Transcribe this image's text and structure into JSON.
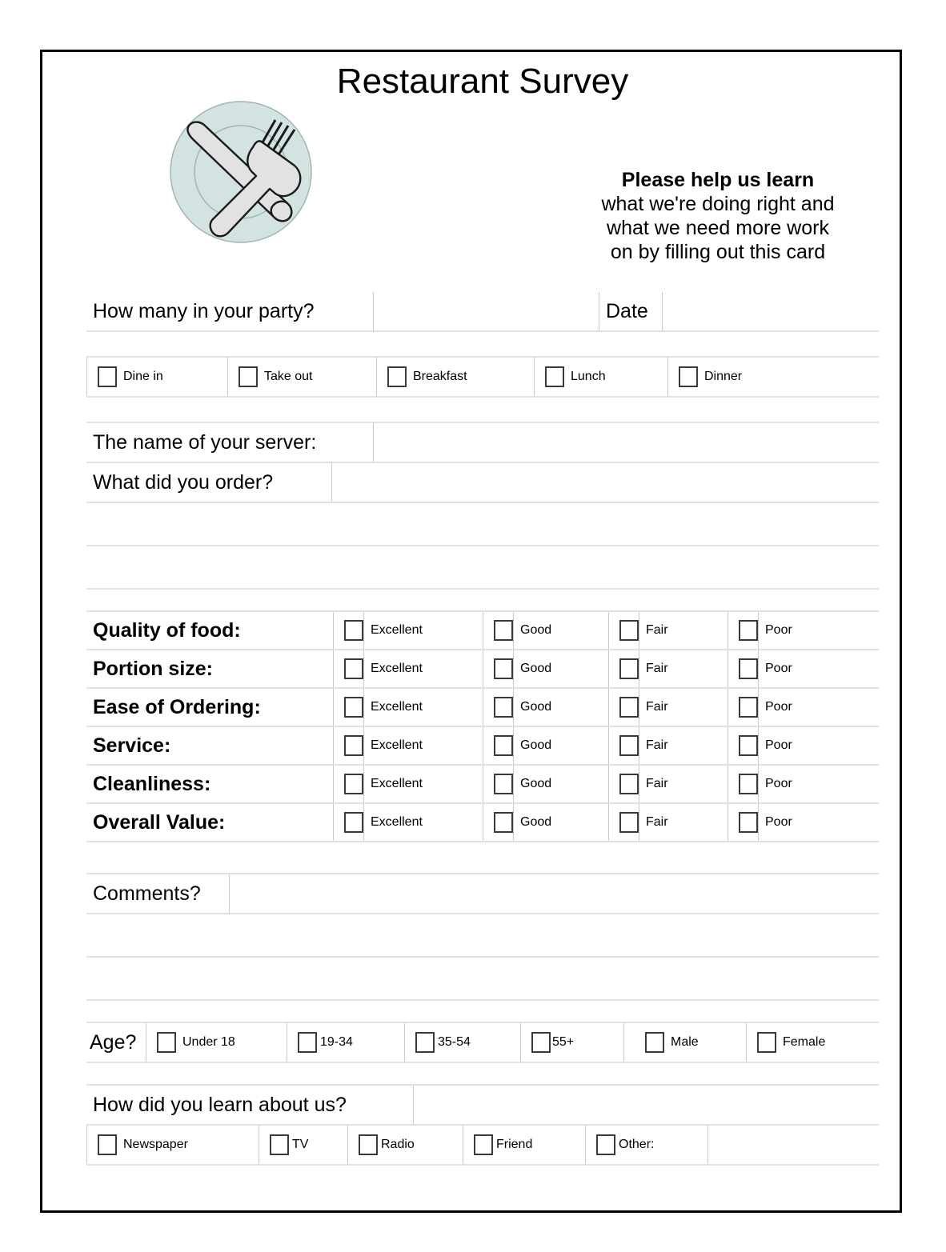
{
  "document": {
    "title": "Restaurant Survey",
    "logo_icon": "plate-with-fork-and-knife-icon",
    "colors": {
      "plate_fill": "#d3e3e2",
      "plate_stroke": "#8fa9a8",
      "cutlery_fill": "#e2e2e2",
      "cutlery_stroke": "#1a1a1a",
      "rule": "#e2e2e2",
      "divider": "#c9c9c9",
      "border": "#000000"
    }
  },
  "intro": {
    "lead": "Please help us learn",
    "line2": "what we're doing right and",
    "line3": "what we need more work",
    "line4": "on by filling out this card"
  },
  "party_row": {
    "party_label": "How many in your party?",
    "party_value": "",
    "date_label": "Date",
    "date_value": ""
  },
  "visit_type": {
    "options": [
      {
        "label": "Dine in",
        "checked": false
      },
      {
        "label": "Take out",
        "checked": false
      },
      {
        "label": "Breakfast",
        "checked": false
      },
      {
        "label": "Lunch",
        "checked": false
      },
      {
        "label": "Dinner",
        "checked": false
      }
    ]
  },
  "server_section": {
    "server_label": "The name of your server:",
    "server_value": "",
    "order_label": "What did you order?",
    "order_value": ""
  },
  "ratings": {
    "scale": [
      "Excellent",
      "Good",
      "Fair",
      "Poor"
    ],
    "rows": [
      {
        "label": "Quality of food:"
      },
      {
        "label": "Portion size:"
      },
      {
        "label": "Ease of Ordering:"
      },
      {
        "label": "Service:"
      },
      {
        "label": "Cleanliness:"
      },
      {
        "label": "Overall Value:"
      }
    ]
  },
  "comments": {
    "label": "Comments?",
    "value": ""
  },
  "demographics": {
    "age_label": "Age?",
    "age_options": [
      {
        "label": "Under 18",
        "checked": false
      },
      {
        "label": "19-34",
        "checked": false
      },
      {
        "label": "35-54",
        "checked": false
      },
      {
        "label": "55+",
        "checked": false
      }
    ],
    "gender_options": [
      {
        "label": "Male",
        "checked": false
      },
      {
        "label": "Female",
        "checked": false
      }
    ]
  },
  "referral": {
    "question": "How did you learn about us?",
    "answer_value": "",
    "options": [
      {
        "label": "Newspaper",
        "checked": false
      },
      {
        "label": "TV",
        "checked": false
      },
      {
        "label": "Radio",
        "checked": false
      },
      {
        "label": "Friend",
        "checked": false
      },
      {
        "label": "Other:",
        "checked": false
      }
    ],
    "other_value": ""
  }
}
